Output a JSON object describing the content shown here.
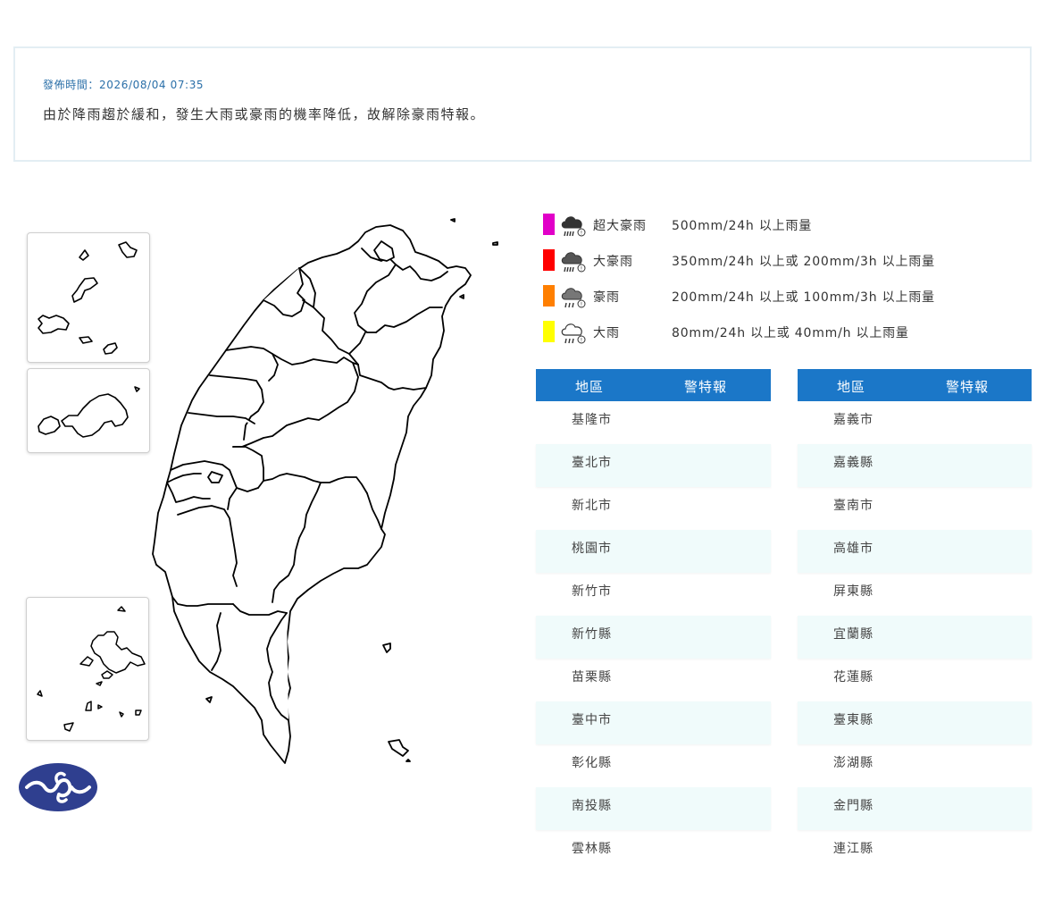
{
  "notice": {
    "time_label": "發佈時間：2026/08/04 07:35",
    "message": "由於降雨趨於緩和，發生大雨或豪雨的機率降低，故解除豪雨特報。"
  },
  "legend": [
    {
      "name": "超大豪雨",
      "desc": "500mm/24h 以上雨量",
      "color": "#e100c8",
      "icon": "extreme-torrential-rain-icon"
    },
    {
      "name": "大豪雨",
      "desc": "350mm/24h 以上或 200mm/3h 以上雨量",
      "color": "#ff0000",
      "icon": "extremely-heavy-rain-icon"
    },
    {
      "name": "豪雨",
      "desc": "200mm/24h 以上或 100mm/3h 以上雨量",
      "color": "#ff7f00",
      "icon": "torrential-rain-icon"
    },
    {
      "name": "大雨",
      "desc": "80mm/24h 以上或 40mm/h 以上雨量",
      "color": "#ffff00",
      "icon": "heavy-rain-icon"
    }
  ],
  "table_headers": {
    "area": "地區",
    "warning": "警特報"
  },
  "table_left": [
    {
      "area": "基隆市",
      "warning": ""
    },
    {
      "area": "臺北市",
      "warning": ""
    },
    {
      "area": "新北市",
      "warning": ""
    },
    {
      "area": "桃園市",
      "warning": ""
    },
    {
      "area": "新竹市",
      "warning": ""
    },
    {
      "area": "新竹縣",
      "warning": ""
    },
    {
      "area": "苗栗縣",
      "warning": ""
    },
    {
      "area": "臺中市",
      "warning": ""
    },
    {
      "area": "彰化縣",
      "warning": ""
    },
    {
      "area": "南投縣",
      "warning": ""
    },
    {
      "area": "雲林縣",
      "warning": ""
    }
  ],
  "table_right": [
    {
      "area": "嘉義市",
      "warning": ""
    },
    {
      "area": "嘉義縣",
      "warning": ""
    },
    {
      "area": "臺南市",
      "warning": ""
    },
    {
      "area": "高雄市",
      "warning": ""
    },
    {
      "area": "屏東縣",
      "warning": ""
    },
    {
      "area": "宜蘭縣",
      "warning": ""
    },
    {
      "area": "花蓮縣",
      "warning": ""
    },
    {
      "area": "臺東縣",
      "warning": ""
    },
    {
      "area": "澎湖縣",
      "warning": ""
    },
    {
      "area": "金門縣",
      "warning": ""
    },
    {
      "area": "連江縣",
      "warning": ""
    }
  ],
  "colors": {
    "header_bg": "#1b77c8",
    "alt_row_bg": "#f0fbfb",
    "time_text": "#2a6fa8",
    "logo_blue": "#2f3f8f"
  }
}
